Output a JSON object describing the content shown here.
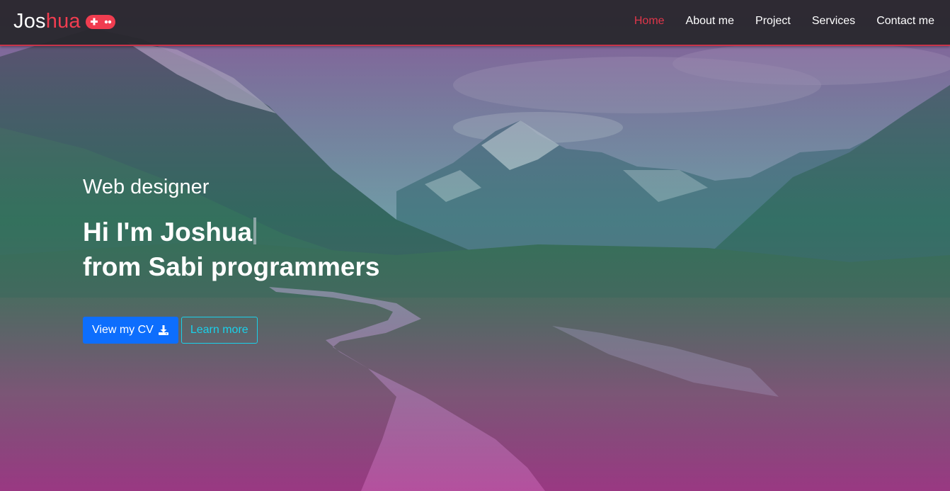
{
  "brand": {
    "first": "Jos",
    "second": "hua",
    "icon": "gamepad-icon"
  },
  "nav": {
    "items": [
      {
        "label": "Home",
        "active": true
      },
      {
        "label": "About me",
        "active": false
      },
      {
        "label": "Project",
        "active": false
      },
      {
        "label": "Services",
        "active": false
      },
      {
        "label": "Contact me",
        "active": false
      }
    ]
  },
  "hero": {
    "subtitle": "Web designer",
    "headline_line1": "Hi I'm Joshua",
    "headline_line2": "from Sabi programmers",
    "primary_button": {
      "label": "View my CV",
      "icon": "download-icon"
    },
    "secondary_button": {
      "label": "Learn more"
    }
  },
  "colors": {
    "accent": "#f03d50",
    "primary": "#0d6efd",
    "outline": "#1ad1ea",
    "navbar": "#26262a"
  }
}
